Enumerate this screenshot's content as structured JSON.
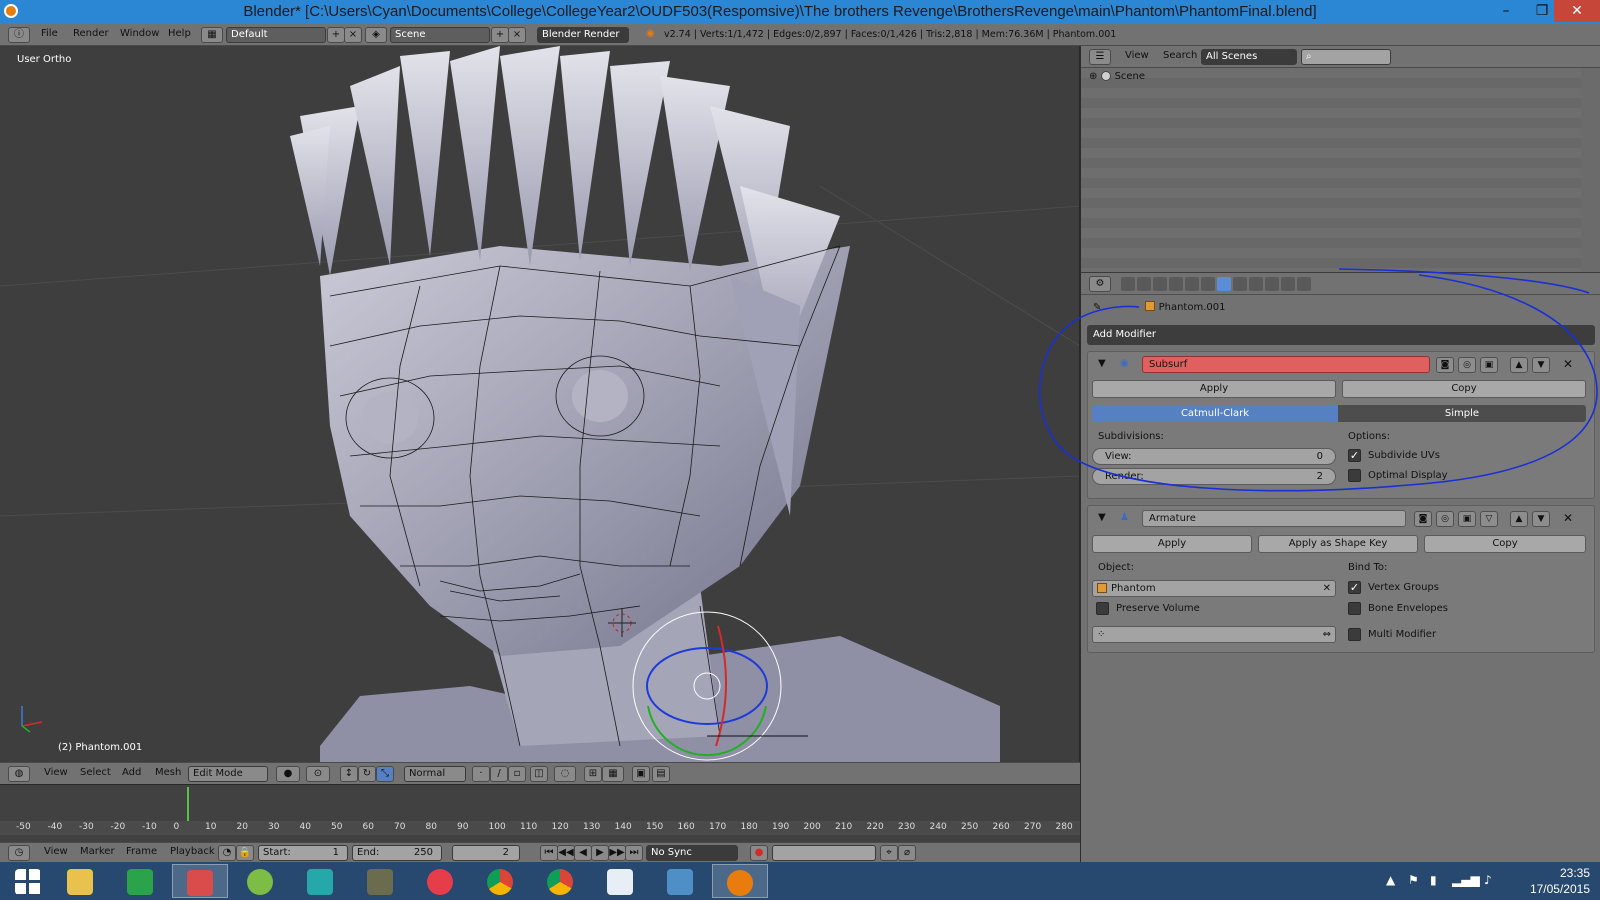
{
  "window": {
    "title": "Blender* [C:\\Users\\Cyan\\Documents\\College\\CollegeYear2\\OUDF503(Respomsive)\\The brothers Revenge\\BrothersRevenge\\main\\Phantom\\PhantomFinal.blend]",
    "minimize": "–",
    "maximize": "❐",
    "close": "✕"
  },
  "info_header": {
    "menus": [
      "File",
      "Render",
      "Window",
      "Help"
    ],
    "layout": "Default",
    "scene": "Scene",
    "engine": "Blender Render",
    "stats": "v2.74 | Verts:1/1,472 | Edges:0/2,897 | Faces:0/1,426 | Tris:2,818 | Mem:76.36M | Phantom.001"
  },
  "viewport": {
    "view_label": "User Ortho",
    "object_label": "(2) Phantom.001"
  },
  "viewport_header": {
    "menus": [
      "View",
      "Select",
      "Add",
      "Mesh"
    ],
    "mode": "Edit Mode",
    "orientation": "Normal"
  },
  "timeline": {
    "ticks": [
      "-50",
      "-40",
      "-30",
      "-20",
      "-10",
      "0",
      "10",
      "20",
      "30",
      "40",
      "50",
      "60",
      "70",
      "80",
      "90",
      "100",
      "110",
      "120",
      "130",
      "140",
      "150",
      "160",
      "170",
      "180",
      "190",
      "200",
      "210",
      "220",
      "230",
      "240",
      "250",
      "260",
      "270",
      "280"
    ],
    "menus": [
      "View",
      "Marker",
      "Frame",
      "Playback"
    ],
    "start_label": "Start:",
    "start_value": "1",
    "end_label": "End:",
    "end_value": "250",
    "current_frame": "2",
    "sync": "No Sync"
  },
  "outliner": {
    "menus": [
      "View",
      "Search"
    ],
    "filter": "All Scenes",
    "scene_item": "Scene"
  },
  "properties": {
    "context_object": "Phantom.001",
    "add_modifier": "Add Modifier",
    "subsurf": {
      "name": "Subsurf",
      "apply": "Apply",
      "copy": "Copy",
      "mode_catmull": "Catmull-Clark",
      "mode_simple": "Simple",
      "subdivisions_label": "Subdivisions:",
      "view_label": "View:",
      "view_value": "0",
      "render_label": "Render:",
      "render_value": "2",
      "options_label": "Options:",
      "subdivide_uvs": "Subdivide UVs",
      "optimal_display": "Optimal Display"
    },
    "armature": {
      "name": "Armature",
      "apply": "Apply",
      "apply_shape": "Apply as Shape Key",
      "copy": "Copy",
      "object_label": "Object:",
      "object_value": "Phantom",
      "preserve_volume": "Preserve Volume",
      "bind_label": "Bind To:",
      "vertex_groups": "Vertex Groups",
      "bone_envelopes": "Bone Envelopes",
      "multi_modifier": "Multi Modifier"
    }
  },
  "taskbar": {
    "icons": [
      "windows-start-icon",
      "file-explorer-icon",
      "store-icon",
      "snipping-tool-icon",
      "map-icon",
      "maya-icon",
      "gimp-icon",
      "itunes-icon",
      "chrome-icon",
      "chrome-app-icon",
      "word-icon",
      "photos-icon",
      "blender-icon"
    ],
    "time": "23:35",
    "date": "17/05/2015"
  },
  "colors": {
    "titlebar": "#2b86d4",
    "header": "#727272",
    "viewport": "#3e3e3e",
    "subsurf_red": "#e06060",
    "active_blue": "#5680c2",
    "annotation": "#1a2fd6",
    "taskbar": "#27486f"
  }
}
